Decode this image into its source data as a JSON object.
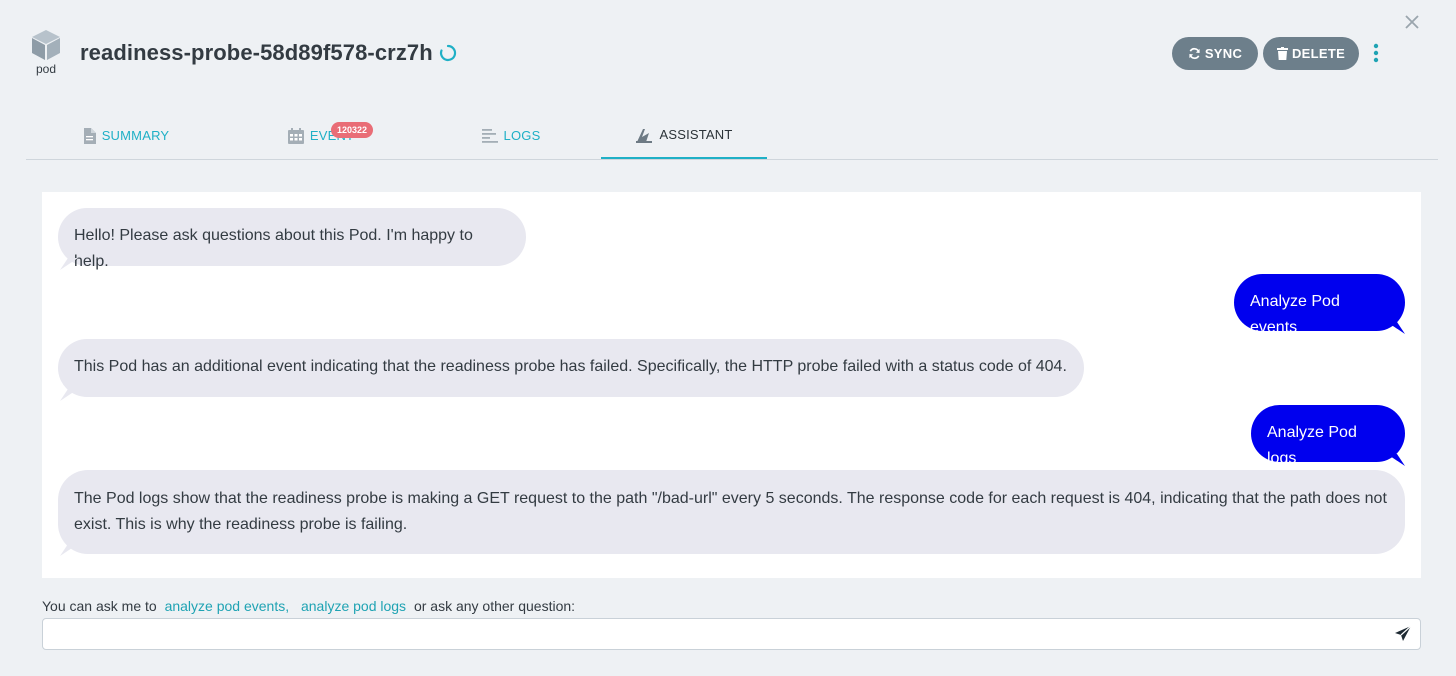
{
  "header": {
    "kind_label": "pod",
    "title": "readiness-probe-58d89f578-crz7h",
    "sync_label": "SYNC",
    "delete_label": "DELETE"
  },
  "tabs": [
    {
      "label": "SUMMARY",
      "icon": "file-icon",
      "active": false
    },
    {
      "label": "EVENTS",
      "icon": "calendar-icon",
      "active": false,
      "badge": "120322"
    },
    {
      "label": "LOGS",
      "icon": "align-left-icon",
      "active": false
    },
    {
      "label": "ASSISTANT",
      "icon": "assistant-icon",
      "active": true
    }
  ],
  "chat": {
    "messages": [
      {
        "role": "assistant",
        "text": "Hello! Please ask questions about this Pod. I'm happy to help."
      },
      {
        "role": "user",
        "text": "Analyze Pod events"
      },
      {
        "role": "assistant",
        "text": "This Pod has an additional event indicating that the readiness probe has failed. Specifically, the HTTP probe failed with a status code of 404."
      },
      {
        "role": "user",
        "text": "Analyze Pod logs"
      },
      {
        "role": "assistant",
        "text": "The Pod logs show that the readiness probe is making a GET request to the path \"/bad-url\" every 5 seconds. The response code for each request is 404, indicating that the path does not exist. This is why the readiness probe is failing."
      }
    ]
  },
  "hint": {
    "prefix": "You can ask me to",
    "link1": "analyze pod events,",
    "link2": "analyze pod logs",
    "suffix": "or ask any other question:"
  },
  "input": {
    "value": "",
    "placeholder": ""
  },
  "colors": {
    "accent": "#1fb0c6",
    "user_bubble": "#0000ee",
    "bot_bubble": "#e8e8f0",
    "badge": "#e96d76",
    "button": "#6d7f8b"
  }
}
